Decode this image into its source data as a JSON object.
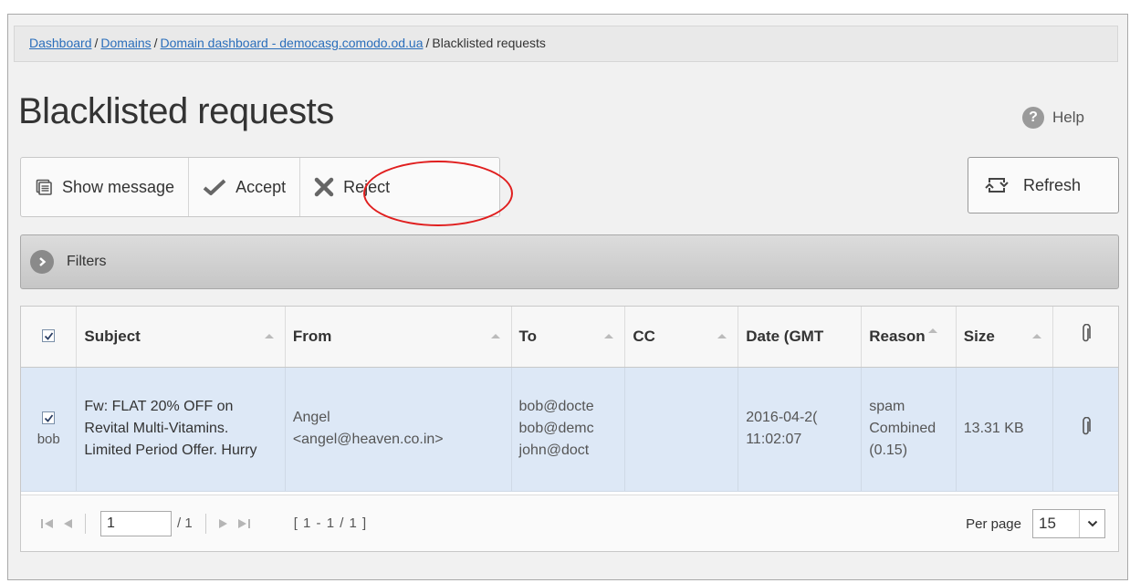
{
  "breadcrumb": {
    "items": [
      "Dashboard",
      "Domains",
      "Domain dashboard - democasg.comodo.od.ua"
    ],
    "current": "Blacklisted requests",
    "separator": "/"
  },
  "page": {
    "title": "Blacklisted requests",
    "help_label": "Help",
    "help_icon": "?"
  },
  "toolbar": {
    "show_message_label": "Show message",
    "accept_label": "Accept",
    "reject_label": "Reject",
    "refresh_label": "Refresh"
  },
  "filters": {
    "label": "Filters"
  },
  "grid": {
    "columns": [
      "Subject",
      "From",
      "To",
      "CC",
      "Date (GMT",
      "Reason",
      "Size"
    ],
    "rows": [
      {
        "user": "bob",
        "subject": "Fw: FLAT 20% OFF on Revital Multi-Vitamins. Limited Period Offer. Hurry",
        "from_name": "Angel",
        "from_email": "<angel@heaven.co.in>",
        "to": [
          "bob@docte",
          "bob@demc",
          "john@doct"
        ],
        "cc": "",
        "date": "2016-04-2(",
        "time": "11:02:07",
        "reason": [
          "spam",
          "Combined",
          "(0.15)"
        ],
        "size": "13.31 KB"
      }
    ]
  },
  "pager": {
    "current_page": "1",
    "total_pages": "/ 1",
    "range": "[ 1 - 1 / 1 ]",
    "per_page_label": "Per page",
    "per_page_value": "15"
  },
  "colors": {
    "accent_annotation": "#e01e1e",
    "link": "#2a6ebb",
    "row_selected": "#dde8f6"
  }
}
